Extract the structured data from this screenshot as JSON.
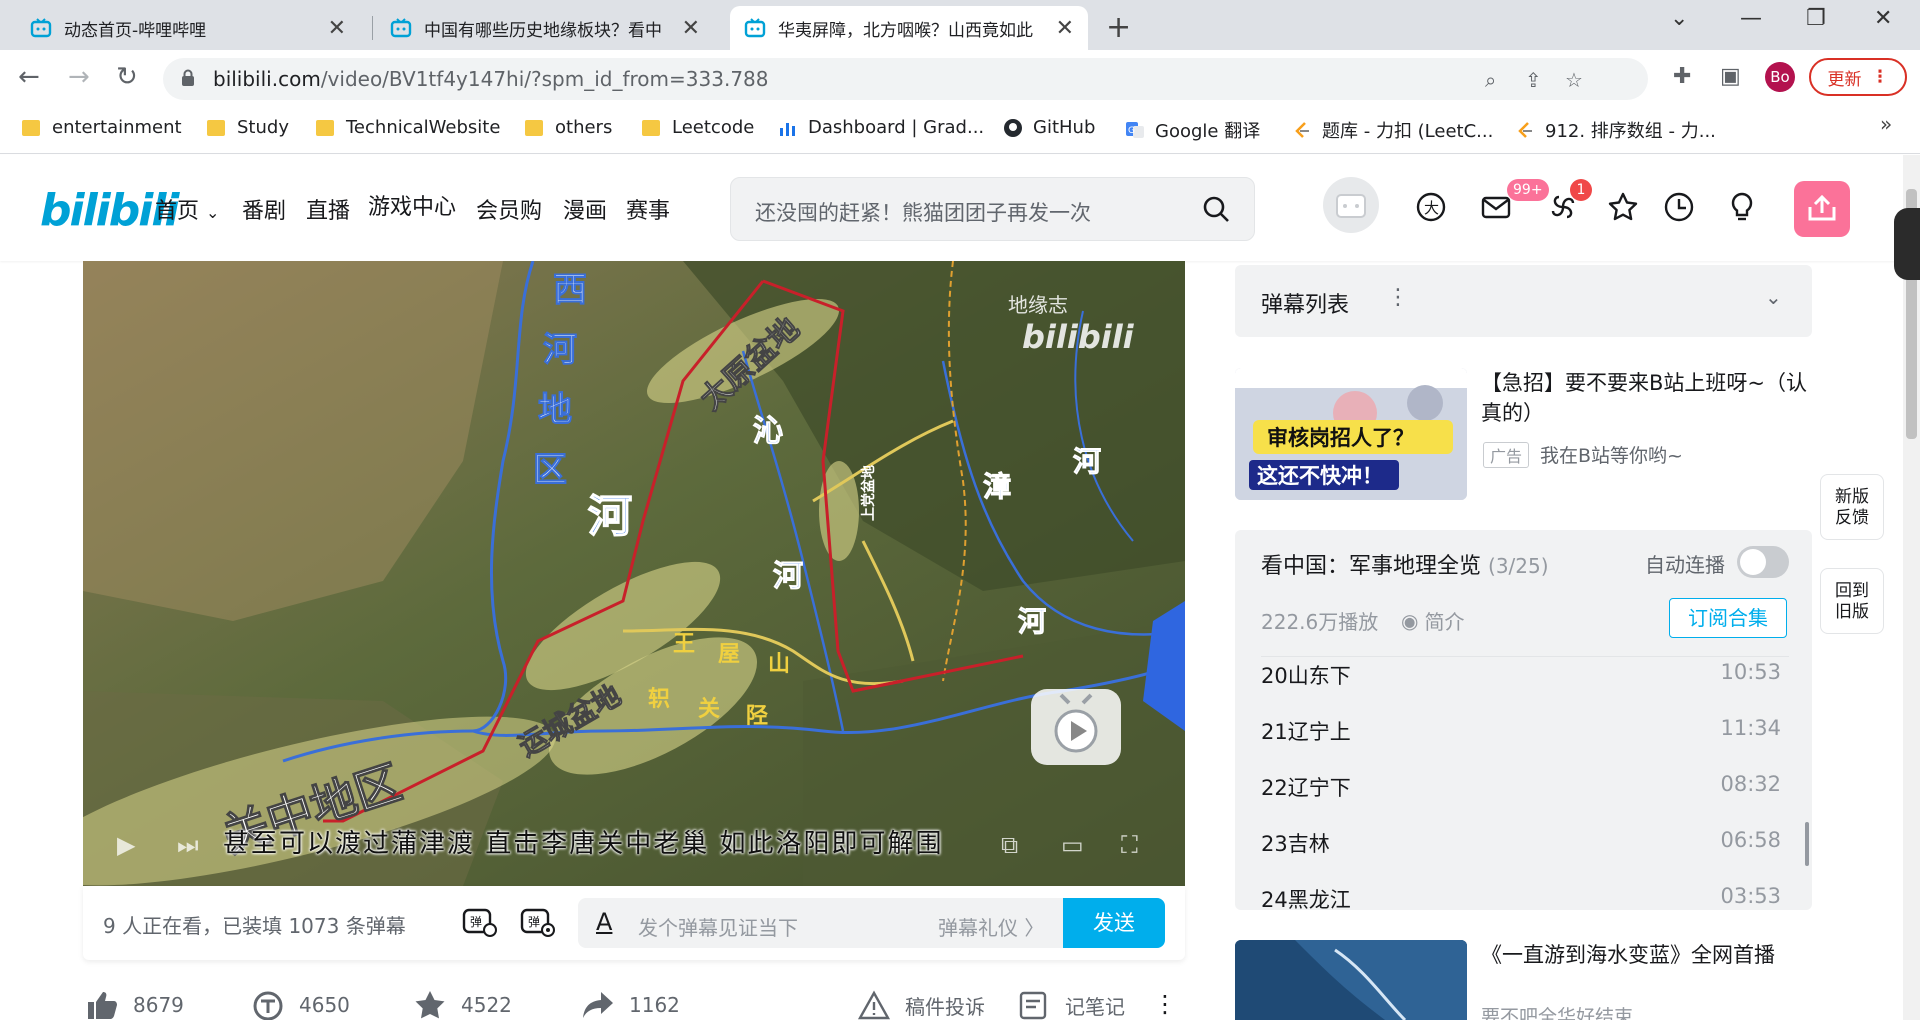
{
  "browser": {
    "tabs": [
      {
        "title": "动态首页-哔哩哔哩"
      },
      {
        "title": "中国有哪些历史地缘板块？看中"
      },
      {
        "title": "华夷屏障，北方咽喉？山西竟如此"
      }
    ],
    "url_host": "bilibili.com",
    "url_path": "/video/BV1tf4y147hi/?spm_id_from=333.788",
    "profile_initials": "Bo",
    "update_label": "更新",
    "bookmarks": [
      {
        "label": "entertainment"
      },
      {
        "label": "Study"
      },
      {
        "label": "TechnicalWebsite"
      },
      {
        "label": "others"
      },
      {
        "label": "Leetcode"
      },
      {
        "label": "Dashboard | Grad..."
      },
      {
        "label": "GitHub"
      },
      {
        "label": "Google 翻译"
      },
      {
        "label": "题库 - 力扣 (LeetC..."
      },
      {
        "label": "912. 排序数组 - 力..."
      }
    ]
  },
  "site": {
    "logo": "bilibili",
    "nav": [
      "首页",
      "番剧",
      "直播",
      "游戏中心",
      "会员购",
      "漫画",
      "赛事"
    ],
    "search_placeholder": "还没囤的赶紧！熊猫团团子再发一次",
    "badges": {
      "messages": "99+",
      "dynamics": "1"
    },
    "header_icons": [
      "vip-icon",
      "message-icon",
      "dynamic-icon",
      "favorite-icon",
      "history-icon",
      "creation-icon",
      "upload-icon"
    ]
  },
  "video": {
    "watermark_text": "地缘志",
    "watermark_logo": "bilibili",
    "subtitle": "甚至可以渡过蒲津渡 直击李唐关中老巢 如此洛阳即可解围",
    "map_labels": {
      "xihe": [
        "西",
        "河",
        "地",
        "区"
      ],
      "taiyuan": "太原盆地",
      "yuncheng": "运城盆地",
      "guanzhong": "关中地区",
      "he_big": "河",
      "qinhe": [
        "沁",
        "河"
      ],
      "zhanghe": [
        "漳",
        "河"
      ],
      "wangwu": [
        "王",
        "屋",
        "山"
      ],
      "zhi": "轵",
      "guan": "关",
      "jing": "陉",
      "he_blue": "河",
      "shangdang": "上党盆地"
    }
  },
  "danmaku_bar": {
    "info": "9 人正在看，已装填 1073 条弹幕",
    "placeholder": "发个弹幕见证当下",
    "etiquette": "弹幕礼仪 〉",
    "send": "发送"
  },
  "actions": [
    {
      "icon": "like-icon",
      "count": "8679"
    },
    {
      "icon": "coin-icon",
      "count": "4650"
    },
    {
      "icon": "star-icon",
      "count": "4522"
    },
    {
      "icon": "share-icon",
      "count": "1162"
    },
    {
      "icon": "report-icon",
      "label": "稿件投诉"
    },
    {
      "icon": "note-icon",
      "label": "记笔记"
    }
  ],
  "danmaku_list": {
    "title": "弹幕列表",
    "more": "⋮"
  },
  "ad": {
    "title": "【急招】要不要来B站上班呀~（认真的）",
    "tag": "广告",
    "subtitle": "我在B站等你哟~",
    "thumb_text_1": "审核岗招人了？",
    "thumb_text_2": "这还不快冲！"
  },
  "playlist": {
    "title": "看中国：军事地理全览",
    "count": "(3/25)",
    "autoplay_label": "自动连播",
    "plays": "222.6万播放",
    "intro": "简介",
    "subscribe": "订阅合集",
    "items": [
      {
        "title": "20山东下",
        "duration": "10:53"
      },
      {
        "title": "21辽宁上",
        "duration": "11:34"
      },
      {
        "title": "22辽宁下",
        "duration": "08:32"
      },
      {
        "title": "23吉林",
        "duration": "06:58"
      },
      {
        "title": "24黑龙江",
        "duration": "03:53"
      }
    ]
  },
  "recommend": {
    "title": "《一直游到海水变蓝》全网首播",
    "partial": "要不吧全华好结束"
  },
  "side_buttons": [
    {
      "label": "新版反馈"
    },
    {
      "label": "回到旧版"
    }
  ],
  "colors": {
    "accent": "#00aeec",
    "pink": "#fb7299",
    "chrome_tabbar": "#dee1e6"
  }
}
